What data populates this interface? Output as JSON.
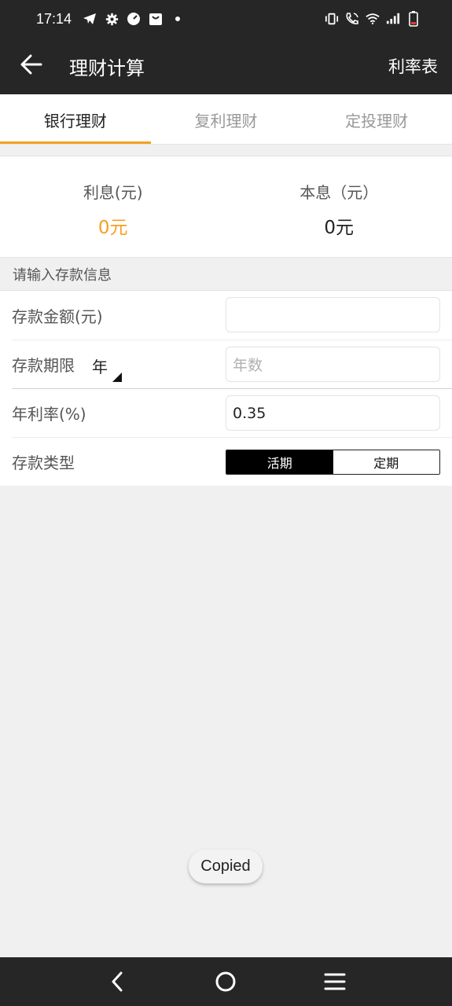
{
  "status_bar": {
    "time": "17:14",
    "left_icons": [
      "telegram-icon",
      "settings-gear-icon",
      "speedometer-icon",
      "shopping-bag-icon",
      "dot-icon"
    ],
    "right_icons": [
      "vibrate-icon",
      "wifi-call-icon",
      "wifi-icon",
      "signal-icon",
      "battery-low-icon"
    ],
    "battery_color": "#e53935"
  },
  "app_bar": {
    "title": "理财计算",
    "action_label": "利率表",
    "back_icon": "arrow-left-icon"
  },
  "tabs": [
    {
      "label": "银行理财",
      "active": true
    },
    {
      "label": "复利理财",
      "active": false
    },
    {
      "label": "定投理财",
      "active": false
    }
  ],
  "summary": {
    "interest_label": "利息(元)",
    "interest_value": "0元",
    "total_label": "本息（元）",
    "total_value": "0元"
  },
  "section_header": "请输入存款信息",
  "form": {
    "amount_label": "存款金额(元)",
    "amount_value": "",
    "term_label": "存款期限",
    "term_unit": "年",
    "term_placeholder": "年数",
    "rate_label": "年利率(%)",
    "rate_value": "0.35",
    "type_label": "存款类型",
    "type_options": [
      "活期",
      "定期"
    ],
    "type_selected": "活期"
  },
  "toast": "Copied",
  "colors": {
    "accent": "#f5a023",
    "bar_bg": "#262626"
  },
  "nav_bar": [
    "back-nav-icon",
    "home-nav-icon",
    "recents-nav-icon"
  ]
}
